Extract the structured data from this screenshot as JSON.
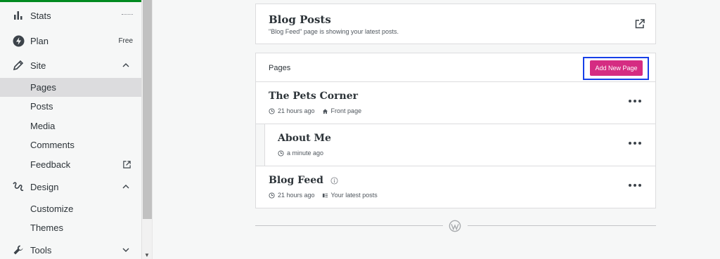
{
  "sidebar": {
    "items": [
      {
        "label": "Stats",
        "icon": "stats-icon"
      },
      {
        "label": "Plan",
        "badge": "Free",
        "icon": "plan-icon"
      },
      {
        "label": "Site",
        "icon": "pencil-icon"
      },
      {
        "label": "Design",
        "icon": "design-icon"
      },
      {
        "label": "Tools",
        "icon": "wrench-icon"
      }
    ],
    "site_sub": [
      "Pages",
      "Posts",
      "Media",
      "Comments",
      "Feedback"
    ],
    "design_sub": [
      "Customize",
      "Themes"
    ],
    "active": "Pages"
  },
  "blog_card": {
    "title": "Blog Posts",
    "subtitle": "\"Blog Feed\" page is showing your latest posts."
  },
  "pages": {
    "header": "Pages",
    "add_button": "Add New Page",
    "rows": [
      {
        "title": "The Pets Corner",
        "time": "21 hours ago",
        "extra": "Front page"
      },
      {
        "title": "About Me",
        "time": "a minute ago"
      },
      {
        "title": "Blog Feed",
        "time": "21 hours ago",
        "extra": "Your latest posts"
      }
    ]
  },
  "colors": {
    "accent": "#d52c82",
    "highlight": "#1740e8",
    "top_bar": "#008a20"
  }
}
